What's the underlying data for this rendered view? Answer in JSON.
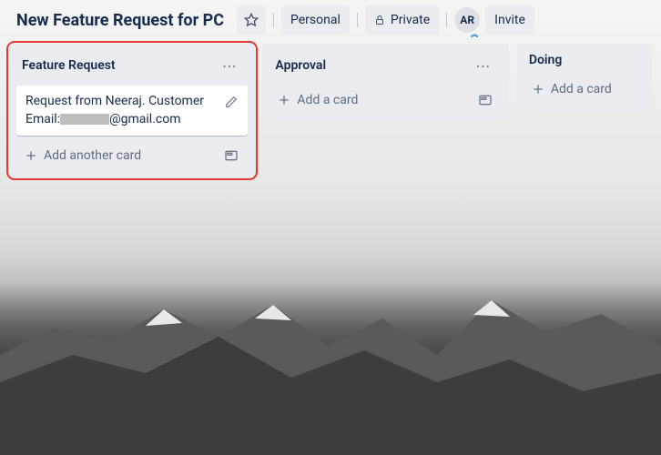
{
  "header": {
    "title": "New Feature Request for PC",
    "visibility_scope": "Personal",
    "privacy": "Private",
    "avatar_initials": "AR",
    "invite_label": "Invite"
  },
  "lists": [
    {
      "title": "Feature Request",
      "highlighted": true,
      "cards": [
        {
          "line1": "Request from Neeraj. Customer",
          "line2_prefix": "Email:",
          "line2_suffix": "@gmail.com",
          "redacted": true
        }
      ],
      "add_label": "Add another card"
    },
    {
      "title": "Approval",
      "highlighted": false,
      "cards": [],
      "add_label": "Add a card"
    },
    {
      "title": "Doing",
      "highlighted": false,
      "cards": [],
      "add_label": "Add a card"
    }
  ]
}
